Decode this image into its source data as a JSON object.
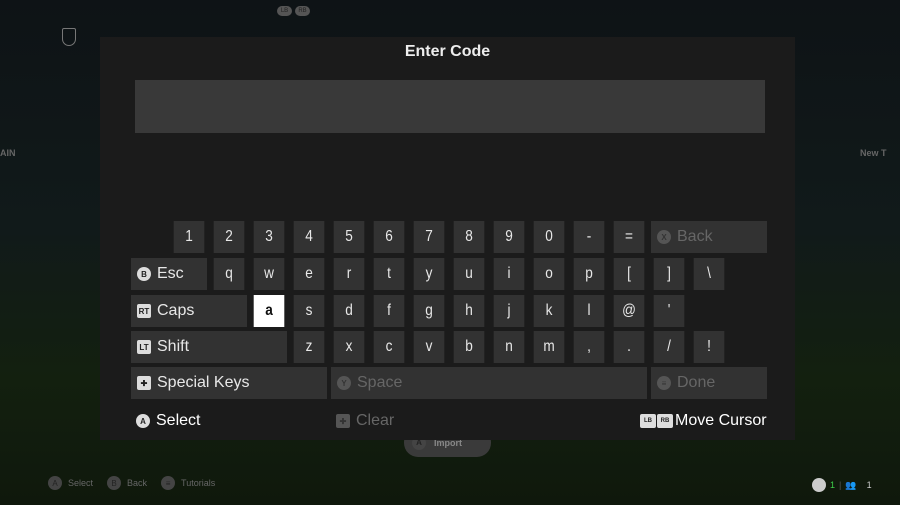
{
  "background": {
    "left_label": "AIN",
    "right_label": "New T",
    "top_buttons": [
      "LB",
      "RB"
    ],
    "import_button": "Import",
    "import_badge": "A"
  },
  "footer": {
    "items": [
      {
        "badge": "A",
        "label": "Select"
      },
      {
        "badge": "B",
        "label": "Back"
      },
      {
        "badge": "≡",
        "label": "Tutorials"
      }
    ],
    "status_count_1": "1",
    "status_count_2": "1"
  },
  "dialog": {
    "title": "Enter Code",
    "input_value": "",
    "rows": [
      [
        "1",
        "2",
        "3",
        "4",
        "5",
        "6",
        "7",
        "8",
        "9",
        "0",
        "-",
        "=",
        "Back"
      ],
      [
        "Esc",
        "q",
        "w",
        "e",
        "r",
        "t",
        "y",
        "u",
        "i",
        "o",
        "p",
        "[",
        "]",
        "\\"
      ],
      [
        "Caps",
        "a",
        "s",
        "d",
        "f",
        "g",
        "h",
        "j",
        "k",
        "l",
        "@",
        "'"
      ],
      [
        "Shift",
        "z",
        "x",
        "c",
        "v",
        "b",
        "n",
        "m",
        ",",
        ".",
        "/",
        "!"
      ],
      [
        "Special Keys",
        "Space",
        "Done"
      ]
    ],
    "badges": {
      "Back": "X",
      "Esc": "B",
      "Caps": "RT",
      "Shift": "LT",
      "Special Keys": "✚",
      "Space": "Y",
      "Done": "≡"
    },
    "selected_key": "a",
    "hints": {
      "select": "Select",
      "select_badge": "A",
      "clear": "Clear",
      "move_cursor": "Move Cursor",
      "move_badges": [
        "LB",
        "RB"
      ]
    }
  },
  "colors": {
    "panel": "#1b1b1b",
    "key": "#323232",
    "selected": "#ffffff",
    "accent_green": "#3ecf4a"
  }
}
